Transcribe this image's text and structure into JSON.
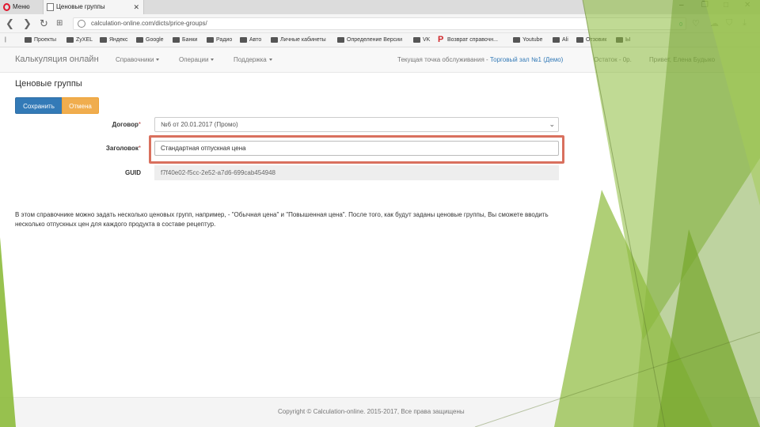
{
  "browser": {
    "tabs": [
      {
        "label": "Меню"
      },
      {
        "label": "Ценовые группы"
      }
    ],
    "url": "calculation-online.com/dicts/price-groups/",
    "url_badge": "0",
    "bookmarks": [
      "Проекты",
      "ZyXEL",
      "Яндекс",
      "Google",
      "Банки",
      "Радио",
      "Авто",
      "Личные кабинеты",
      "Определение Версии",
      "VK",
      "Возврат справочн...",
      "Youtube",
      "Ali",
      "Отзовик",
      "Ы"
    ]
  },
  "app": {
    "brand": "Калькуляция онлайн",
    "menu": [
      "Справочники",
      "Операции",
      "Поддержка"
    ],
    "service_prefix": "Текущая точка обслуживания - ",
    "service_link": "Торговый зал №1 (Демо)",
    "balance": "Остаток - 0р.",
    "greeting": "Привет, Елена Будыко"
  },
  "page": {
    "title": "Ценовые группы",
    "save_label": "Сохранить",
    "cancel_label": "Отмена",
    "fields": {
      "contract_label": "Договор",
      "contract_value": "№6 от 20.01.2017 (Промо)",
      "title_label": "Заголовок",
      "title_value": "Стандартная отпускная цена",
      "guid_label": "GUID",
      "guid_value": "f7f40e02-f5cc-2e52-a7d6-699cab454948"
    },
    "help_text": "В этом справочнике можно задать несколько ценовых групп, например, - \"Обычная цена\" и \"Повышенная цена\". После того, как будут заданы ценовые группы, Вы сможете вводить несколько отпускных цен для каждого продукта в составе рецептур.",
    "footer": "Copyright © Calculation-online. 2015-2017, Все права защищены"
  },
  "colors": {
    "primary": "#337ab7",
    "warning": "#f0ad4e",
    "highlight": "#d9705e",
    "deco_green": "#8dbb3c"
  }
}
